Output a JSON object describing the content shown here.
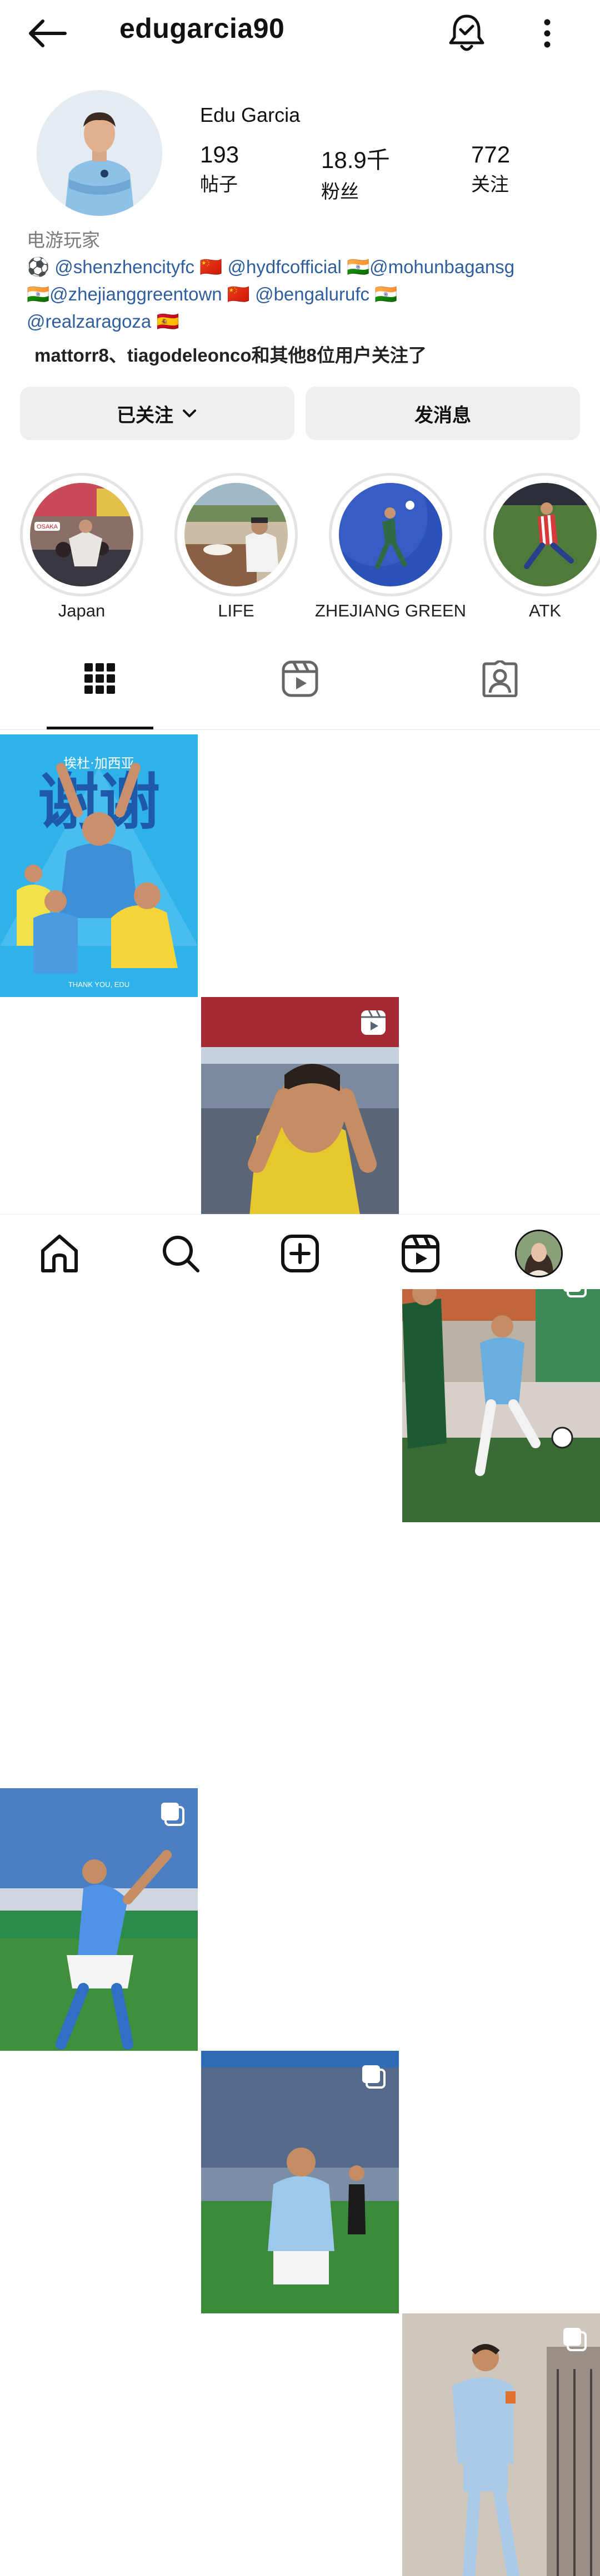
{
  "header": {
    "username": "edugarcia90"
  },
  "profile": {
    "display_name": "Edu Garcia",
    "stats": [
      {
        "value": "193",
        "label": "帖子"
      },
      {
        "value": "18.9千",
        "label": "粉丝"
      },
      {
        "value": "772",
        "label": "关注"
      }
    ],
    "category": "电游玩家",
    "bio": {
      "line1": {
        "ball": "⚽",
        "m1": "@shenzhencityfc",
        "f1": "🇨🇳",
        "m2": "@hydfcofficial",
        "f2": "🇮🇳",
        "m3": "@mohunbagansg"
      },
      "line2": {
        "f0": "🇮🇳",
        "m1": "@zhejianggreentown",
        "f1": "🇨🇳",
        "m2": "@bengalurufc",
        "f2": "🇮🇳"
      },
      "line3": {
        "m1": "@realzaragoza",
        "f1": "🇪🇸"
      }
    },
    "followed_by": "mattorr8、tiagodeleonco和其他8位用户关注了"
  },
  "actions": {
    "following_label": "已关注",
    "message_label": "发消息"
  },
  "highlights": [
    {
      "label": "Japan",
      "sign": "OSAKA"
    },
    {
      "label": "LIFE"
    },
    {
      "label": "ZHEJIANG GREEN"
    },
    {
      "label": "ATK"
    }
  ],
  "tabs": [
    {
      "icon": "grid-icon",
      "selected": true
    },
    {
      "icon": "reels-icon",
      "selected": false
    },
    {
      "icon": "tagged-icon",
      "selected": false
    }
  ],
  "posts": [
    {
      "type": "image",
      "top_text": "埃杜·加西亚",
      "big_text": "谢谢",
      "bottom_text": "THANK YOU, EDU"
    },
    {
      "type": "reel"
    },
    {
      "type": "carousel"
    },
    {
      "type": "carousel"
    },
    {
      "type": "carousel"
    },
    {
      "type": "carousel"
    }
  ],
  "bottom_nav": [
    {
      "icon": "home-icon"
    },
    {
      "icon": "search-icon"
    },
    {
      "icon": "create-icon"
    },
    {
      "icon": "reels-icon"
    },
    {
      "icon": "profile-avatar"
    }
  ],
  "colors": {
    "link": "#2e5e9e",
    "button_bg": "#efefef",
    "secondary_text": "#7a7a7a"
  }
}
